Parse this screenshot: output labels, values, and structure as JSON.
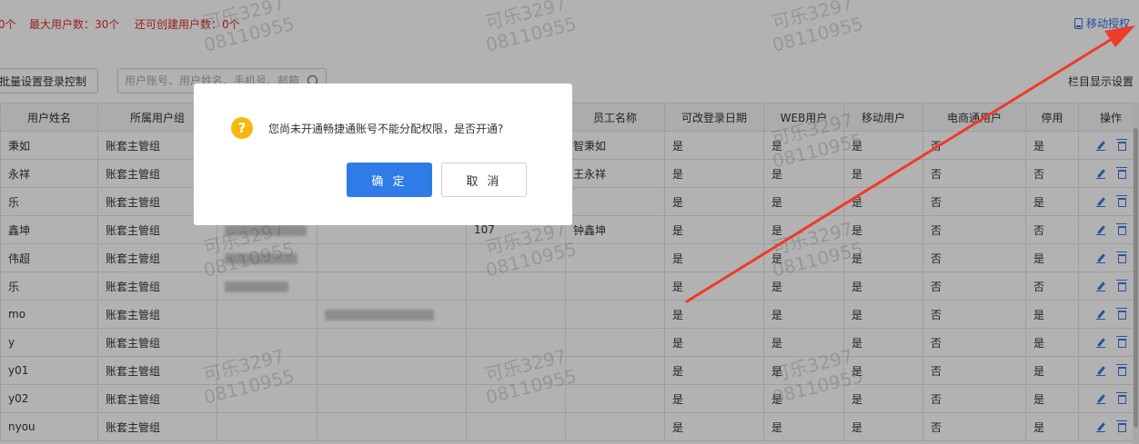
{
  "stats": {
    "current_users": "0个",
    "max_users": "最大用户数：30个",
    "remaining_users": "还可创建用户数：0个"
  },
  "mobile_auth_label": "移动授权",
  "toolbar": {
    "batch_button": "批量设置登录控制",
    "search_placeholder": "用户账号、用户姓名、手机号、邮箱",
    "column_settings": "栏目显示设置"
  },
  "table": {
    "headers": [
      "用户姓名",
      "所属用户组",
      "",
      "",
      "",
      "员工名称",
      "可改登录日期",
      "WEB用户",
      "移动用户",
      "电商通用户",
      "停用",
      "操作"
    ],
    "rows": [
      {
        "name": "秉如",
        "group": "账套主管组",
        "code": "",
        "employee": "智秉如",
        "change_login": "是",
        "web": "是",
        "mobile": "是",
        "ecommerce": "否",
        "disabled": "是"
      },
      {
        "name": "永祥",
        "group": "账套主管组",
        "code": "",
        "employee": "王永祥",
        "change_login": "是",
        "web": "是",
        "mobile": "是",
        "ecommerce": "否",
        "disabled": "否"
      },
      {
        "name": "乐",
        "group": "账套主管组",
        "code": "",
        "employee": "",
        "change_login": "是",
        "web": "是",
        "mobile": "是",
        "ecommerce": "否",
        "disabled": "是"
      },
      {
        "name": "鑫坤",
        "group": "账套主管组",
        "code": "107",
        "employee": "钟鑫坤",
        "change_login": "是",
        "web": "是",
        "mobile": "是",
        "ecommerce": "否",
        "disabled": "否"
      },
      {
        "name": "伟超",
        "group": "账套主管组",
        "code": "",
        "employee": "",
        "change_login": "是",
        "web": "是",
        "mobile": "是",
        "ecommerce": "否",
        "disabled": "是"
      },
      {
        "name": "乐",
        "group": "账套主管组",
        "code": "",
        "employee": "",
        "change_login": "是",
        "web": "是",
        "mobile": "是",
        "ecommerce": "否",
        "disabled": "否"
      },
      {
        "name": "mo",
        "group": "账套主管组",
        "code": "",
        "employee": "",
        "change_login": "是",
        "web": "是",
        "mobile": "是",
        "ecommerce": "否",
        "disabled": "是"
      },
      {
        "name": "y",
        "group": "账套主管组",
        "code": "",
        "employee": "",
        "change_login": "是",
        "web": "是",
        "mobile": "是",
        "ecommerce": "否",
        "disabled": "是"
      },
      {
        "name": "y01",
        "group": "账套主管组",
        "code": "",
        "employee": "",
        "change_login": "是",
        "web": "是",
        "mobile": "是",
        "ecommerce": "否",
        "disabled": "是"
      },
      {
        "name": "y02",
        "group": "账套主管组",
        "code": "",
        "employee": "",
        "change_login": "是",
        "web": "是",
        "mobile": "是",
        "ecommerce": "否",
        "disabled": "是"
      },
      {
        "name": "nyou",
        "group": "账套主管组",
        "code": "",
        "employee": "",
        "change_login": "是",
        "web": "是",
        "mobile": "是",
        "ecommerce": "否",
        "disabled": "是"
      }
    ]
  },
  "watermark": {
    "line1": "可乐3297",
    "line2": "08110955"
  },
  "dialog": {
    "message": "您尚未开通畅捷通账号不能分配权限，是否开通?",
    "confirm": "确 定",
    "cancel": "取 消"
  },
  "colors": {
    "primary": "#2f7be8",
    "danger": "#e02b2b",
    "warning": "#f6b90b",
    "annotation_arrow": "#f03a2a"
  }
}
